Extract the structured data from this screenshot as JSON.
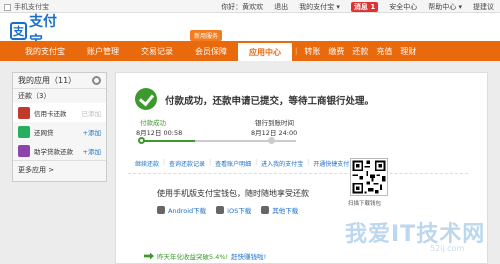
{
  "topbar": {
    "home_label": "手机支付宝",
    "links": [
      {
        "label": "你好：黄欢欢"
      },
      {
        "label": "退出"
      },
      {
        "label": "我的支付宝 ▾"
      },
      {
        "label": "消息 1",
        "badge": true
      },
      {
        "label": "安全中心"
      },
      {
        "label": "帮助中心 ▾"
      },
      {
        "label": "提建议"
      }
    ]
  },
  "logo": {
    "mark": "支",
    "text": "支付宝"
  },
  "nav": {
    "items": [
      {
        "label": "我的支付宝",
        "active": false
      },
      {
        "label": "账户管理",
        "active": false
      },
      {
        "label": "交易记录",
        "active": false
      },
      {
        "label": "会员保障",
        "active": false,
        "tag": "新用服务"
      },
      {
        "label": "应用中心",
        "active": true
      }
    ],
    "quick_links": [
      "转账",
      "缴费",
      "还款",
      "充值",
      "理财"
    ]
  },
  "sidebar": {
    "title": "我的应用（11）",
    "section": "还款（3）",
    "apps": [
      {
        "name": "信用卡还款",
        "add": "已添加",
        "muted": true,
        "color": "#c0392b"
      },
      {
        "name": "还网贷",
        "add": "+添加",
        "muted": false,
        "color": "#27ae60"
      },
      {
        "name": "助学贷款还款",
        "add": "+添加",
        "muted": false,
        "color": "#8e44ad"
      }
    ],
    "more": "更多应用 >"
  },
  "main": {
    "headline": "付款成功，还款申请已提交，等待工商银行处理。",
    "steps": [
      {
        "label": "付款成功",
        "date": "8月12日",
        "time": "00:58"
      },
      {
        "label": "银行到账时间",
        "date": "8月12日",
        "time": "24:00"
      }
    ],
    "progress_fraction": 0.35,
    "actions": [
      "继续还款",
      "查询还款记录",
      "查看账户明细",
      "进入我的支付宝",
      "开通快捷支付"
    ],
    "wallet_title": "使用手机版支付宝钱包，随时随地享受还款",
    "downloads": [
      "Android下载",
      "iOS下载",
      "其他下载"
    ],
    "qr_caption": "扫描下载钱包",
    "promo_text": "昨天年化收益突破5.4%!",
    "promo_link": "赶快赚钱啦!"
  },
  "watermark": {
    "text": "我爱IT技术网",
    "sub": "52ij.com"
  },
  "colors": {
    "brand_orange": "#e9690d",
    "brand_blue": "#1a6fc9",
    "success_green": "#3c9a2d"
  }
}
